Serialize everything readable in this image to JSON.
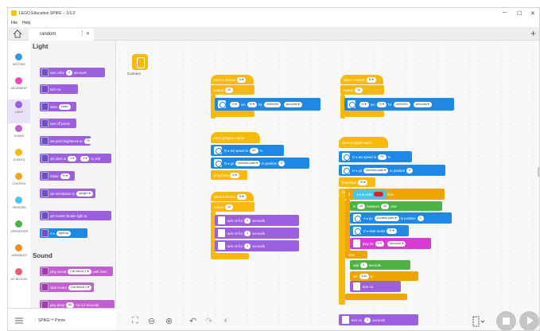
{
  "window": {
    "title": "LEGO Education SPIKE – 3.6.0",
    "minimize": "─",
    "maximize": "☐",
    "close": "✕"
  },
  "menu": {
    "file": "File",
    "help": "Help"
  },
  "tabs": {
    "active": "random",
    "dots": "⋮",
    "close": "✕",
    "add": "+"
  },
  "categories": [
    {
      "name": "MOTORS",
      "color": "#2f9bf0"
    },
    {
      "name": "MOVEMENT",
      "color": "#e64bb8"
    },
    {
      "name": "LIGHT",
      "color": "#9b5fe0"
    },
    {
      "name": "SOUND",
      "color": "#c25fd1"
    },
    {
      "name": "EVENTS",
      "color": "#f6b90c"
    },
    {
      "name": "CONTROL",
      "color": "#f7a31c"
    },
    {
      "name": "SENSORS",
      "color": "#46c6ec"
    },
    {
      "name": "OPERATORS",
      "color": "#4bb343"
    },
    {
      "name": "VARIABLES",
      "color": "#f58b1f"
    },
    {
      "name": "MY BLOCKS",
      "color": "#ee5b6e"
    }
  ],
  "palette": {
    "light_title": "Light",
    "sound_title": "Sound",
    "light_blocks": [
      {
        "text": "turn on",
        "v1": "",
        "v2": "for",
        "v3": "2",
        "v4": "seconds"
      },
      {
        "text": "turn on",
        "v1": "",
        "v2": "",
        "v3": "",
        "v4": ""
      },
      {
        "text": "write",
        "v1": "Hello",
        "v2": "",
        "v3": "",
        "v4": ""
      },
      {
        "text": "turn off pixels",
        "v1": "",
        "v2": "",
        "v3": "",
        "v4": ""
      },
      {
        "text": "set pixel brightness to",
        "v1": "75",
        "v2": "%",
        "v3": "",
        "v4": ""
      },
      {
        "text": "set pixel at",
        "v1": "1 ▾",
        "v2": ",",
        "v3": "1 ▾",
        "v4": "to 100"
      },
      {
        "text": "rotate",
        "v1": "↻ ▾",
        "v2": "",
        "v3": "",
        "v4": ""
      },
      {
        "text": "set orientation to",
        "v1": "upright ▾",
        "v2": "",
        "v3": "",
        "v4": ""
      },
      {
        "text": "set Center Button light to",
        "v1": "",
        "v2": "",
        "v3": "",
        "v4": ""
      },
      {
        "text": "A ▾",
        "v1": "light up",
        "v2": "",
        "v3": "",
        "v4": ""
      }
    ],
    "sound_blocks": [
      {
        "text": "play sound",
        "v1": "Cat Meow 1 ▾",
        "v2": "until done"
      },
      {
        "text": "start sound",
        "v1": "Cat Meow 1 ▾",
        "v2": ""
      },
      {
        "text": "play beep",
        "v1": "60",
        "v2": "for 0.2 seconds"
      }
    ],
    "hub_label": "SPIKE™ Prime"
  },
  "canvas": {
    "connect_label": "Connect",
    "controls": {
      "zoom_fit": "⛶",
      "zoom_out": "⊖",
      "zoom_in": "⊕",
      "undo": "↶",
      "redo": "↷",
      "collapse": "‹"
    }
  },
  "blocks": {
    "s1": {
      "hat": "when I receive",
      "hat_val": "A ▾",
      "repeat": "repeat",
      "repeat_n": "10",
      "motor": "D ▾",
      "run": "run",
      "dir": "↻ ▾",
      "for": "for",
      "amount": "1000000",
      "unit": "seconds ▾"
    },
    "s2": {
      "hat": "when program starts",
      "r1": "D ▾ set speed to",
      "r1v": "50",
      "r1u": "%",
      "r2": "D ▾ go",
      "r2a": "shortest path ▾",
      "r2b": "to position",
      "r2v": "0",
      "bc": "broadcast",
      "bcv": "A ▾"
    },
    "s3": {
      "hat": "when I receive",
      "hat_val": "B ▾",
      "repeat": "repeat",
      "repeat_n": "10",
      "t1": "turn on",
      "t1b": "for",
      "t1v": "1",
      "t1u": "seconds"
    },
    "s4": {
      "hat": "when I receive",
      "hat_val": "B ▾",
      "repeat": "repeat",
      "repeat_n": "10",
      "motor": "D ▾",
      "run": "run",
      "dir": "↻ ▾",
      "for": "for",
      "amount": "1000000",
      "unit": "seconds ▾"
    },
    "s5": {
      "hat": "when program starts",
      "r1": "D ▾ set speed to",
      "r1v": "75",
      "r1u": "%",
      "r2": "D ▾ go",
      "r2a": "shortest path ▾",
      "r2b": "to position",
      "r2v": "0",
      "bc": "broadcast",
      "bcv": "B ▾",
      "forever": "forever",
      "if": "if",
      "cond_a": "A ▾",
      "cond_b": "is color",
      "and": "and",
      "c1": "is",
      "c1b": "between",
      "c1v1": "10",
      "c1v2": "and",
      "c1v3": "25",
      "then": "then",
      "g1": "A ▾ go",
      "g1a": "shortest path ▾",
      "g1b": "to position",
      "g1v": "0",
      "g2": "D ▾ start motor",
      "g2a": "↻ ▾",
      "play": "play",
      "beep": "for",
      "beepv": "0.5",
      "beepu": "seconds ▾",
      "else": "else",
      "wait": "wait",
      "waitv": "1",
      "waitu": "seconds",
      "set_var": "set",
      "set_var_v": "100",
      "to": "to",
      "last": "turn on",
      "lastv": "2",
      "lastu": "seconds"
    }
  }
}
